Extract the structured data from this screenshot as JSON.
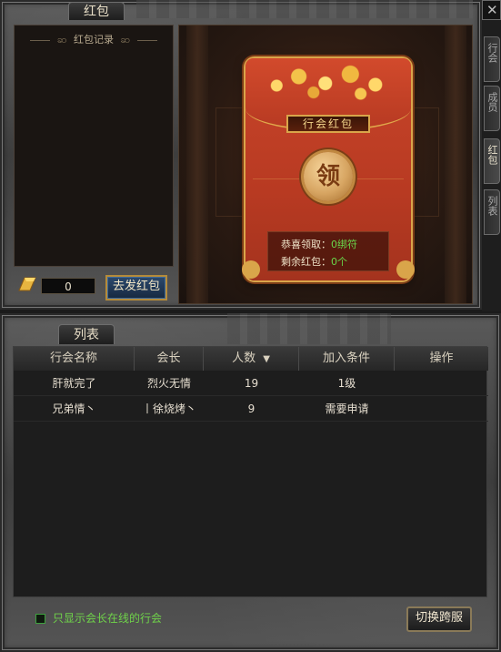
{
  "red_packet_window": {
    "title": "红包",
    "records_title": "红包记录",
    "gold_amount": "0",
    "send_button": "去发红包",
    "envelope": {
      "banner": "行会红包",
      "seal_char": "领",
      "info": [
        {
          "label": "恭喜领取：",
          "value": "0绑符"
        },
        {
          "label": "剩余红包：",
          "value": "0个"
        }
      ]
    }
  },
  "side_tabs": [
    {
      "label": "行会",
      "active": false
    },
    {
      "label": "成员",
      "active": false
    },
    {
      "label": "红包",
      "active": true
    },
    {
      "label": "列表",
      "active": false
    }
  ],
  "list_window": {
    "title": "列表",
    "columns": [
      "行会名称",
      "会长",
      "人数",
      "加入条件",
      "操作"
    ],
    "sort_indicator": "▼",
    "rows": [
      {
        "name": "肝就完了",
        "leader": "烈火无情",
        "count": "19",
        "condition": "1级",
        "action": ""
      },
      {
        "name": "兄弟情丶",
        "leader": "丨徐烧烤丶",
        "count": "9",
        "condition": "需要申请",
        "action": ""
      }
    ],
    "filter_label": "只显示会长在线的行会",
    "filter_checked": false,
    "switch_button": "切换跨服"
  },
  "colors": {
    "accent_gold": "#d9a54a",
    "envelope_red": "#c8452a",
    "info_green": "#69d64a"
  }
}
